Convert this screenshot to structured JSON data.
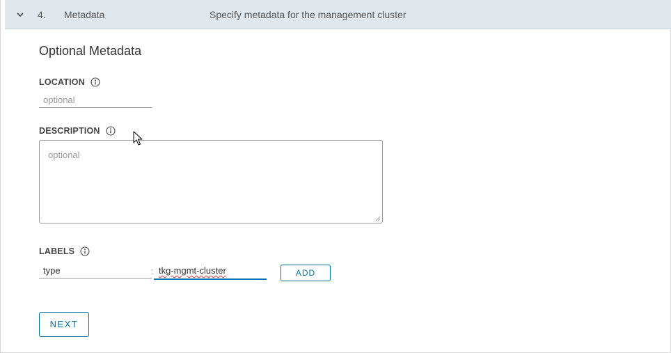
{
  "step": {
    "number": "4.",
    "title": "Metadata",
    "description": "Specify metadata for the management cluster"
  },
  "section": {
    "title": "Optional Metadata"
  },
  "location": {
    "label": "LOCATION",
    "placeholder": "optional",
    "value": ""
  },
  "description_field": {
    "label": "DESCRIPTION",
    "placeholder": "optional",
    "value": ""
  },
  "labels": {
    "label": "LABELS",
    "key_value": "type",
    "separator": ":",
    "value_value": "tkg-mgmt-cluster",
    "add_button": "ADD"
  },
  "next_button": "NEXT",
  "icons": {
    "step_toggle": "chevron-down-icon",
    "info": "info-icon",
    "cursor": "mouse-pointer-icon"
  },
  "colors": {
    "header_bg": "#e1e8ed",
    "accent": "#0072a3",
    "spellcheck": "#d9363e"
  }
}
